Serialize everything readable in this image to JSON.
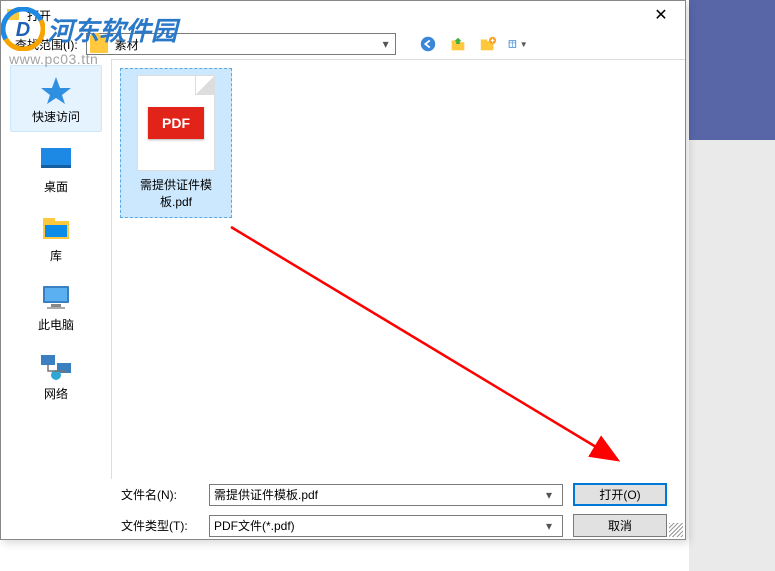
{
  "dialog": {
    "title": "打开",
    "close": "✕"
  },
  "watermark": {
    "text": "河东软件园",
    "sub": "www.pc03.ttn"
  },
  "toolbar": {
    "lookin_label": "查找范围(I):",
    "folder_name": "素材"
  },
  "sidebar": {
    "items": [
      {
        "label": "快速访问"
      },
      {
        "label": "桌面"
      },
      {
        "label": "库"
      },
      {
        "label": "此电脑"
      },
      {
        "label": "网络"
      }
    ]
  },
  "file": {
    "name": "需提供证件模板.pdf",
    "badge": "PDF"
  },
  "bottom": {
    "filename_label": "文件名(N):",
    "filetype_label": "文件类型(T):",
    "filename_value": "需提供证件模板.pdf",
    "filetype_value": "PDF文件(*.pdf)",
    "open_btn": "打开(O)",
    "cancel_btn": "取消"
  }
}
